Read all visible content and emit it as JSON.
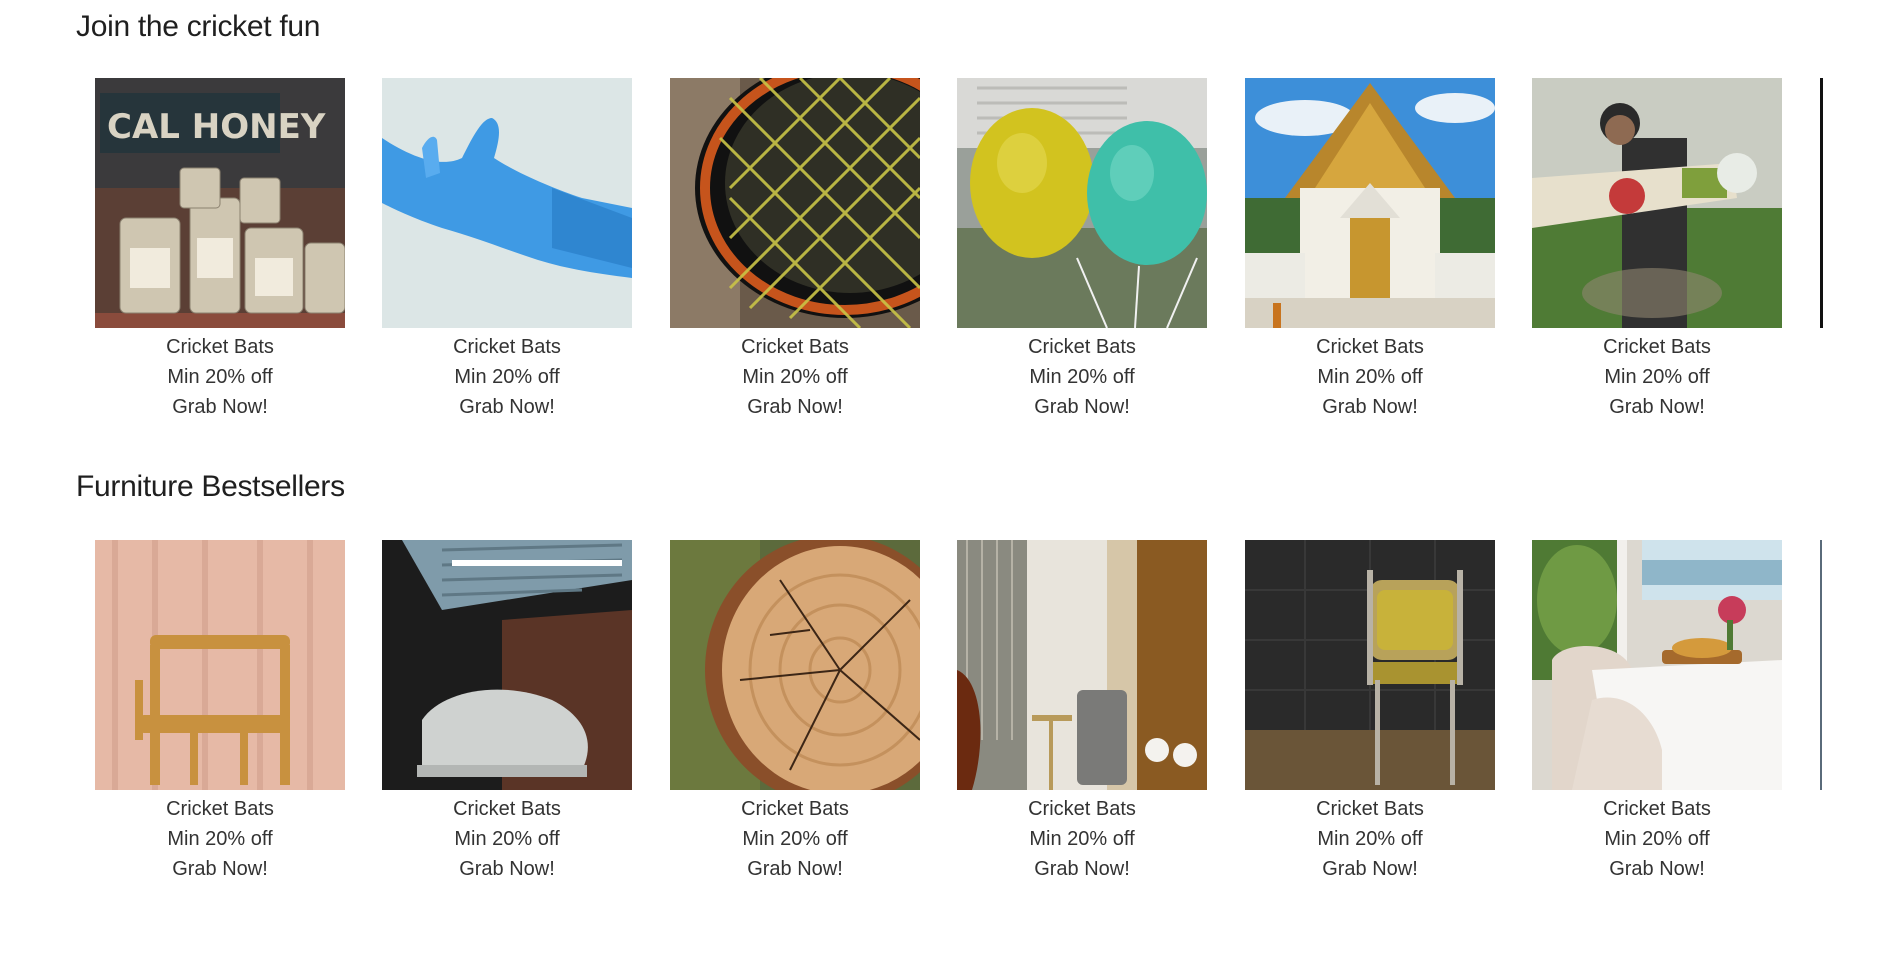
{
  "sections": [
    {
      "title": "Join the cricket fun",
      "cards": [
        {
          "image": "honey-jars-photo",
          "name": "Cricket Bats",
          "offer": "Min 20% off",
          "cta": "Grab Now!"
        },
        {
          "image": "blue-glove-photo",
          "name": "Cricket Bats",
          "offer": "Min 20% off",
          "cta": "Grab Now!"
        },
        {
          "image": "racket-strings-photo",
          "name": "Cricket Bats",
          "offer": "Min 20% off",
          "cta": "Grab Now!"
        },
        {
          "image": "balloons-photo",
          "name": "Cricket Bats",
          "offer": "Min 20% off",
          "cta": "Grab Now!"
        },
        {
          "image": "temple-photo",
          "name": "Cricket Bats",
          "offer": "Min 20% off",
          "cta": "Grab Now!"
        },
        {
          "image": "cricket-player-photo",
          "name": "Cricket Bats",
          "offer": "Min 20% off",
          "cta": "Grab Now!"
        }
      ]
    },
    {
      "title": "Furniture Bestsellers",
      "cards": [
        {
          "image": "wooden-chair-photo",
          "name": "Cricket Bats",
          "offer": "Min 20% off",
          "cta": "Grab Now!"
        },
        {
          "image": "covered-car-garage-photo",
          "name": "Cricket Bats",
          "offer": "Min 20% off",
          "cta": "Grab Now!"
        },
        {
          "image": "tree-stump-photo",
          "name": "Cricket Bats",
          "offer": "Min 20% off",
          "cta": "Grab Now!"
        },
        {
          "image": "interior-room-photo",
          "name": "Cricket Bats",
          "offer": "Min 20% off",
          "cta": "Grab Now!"
        },
        {
          "image": "yellow-chair-photo",
          "name": "Cricket Bats",
          "offer": "Min 20% off",
          "cta": "Grab Now!"
        },
        {
          "image": "dining-table-photo",
          "name": "Cricket Bats",
          "offer": "Min 20% off",
          "cta": "Grab Now!"
        }
      ]
    }
  ]
}
